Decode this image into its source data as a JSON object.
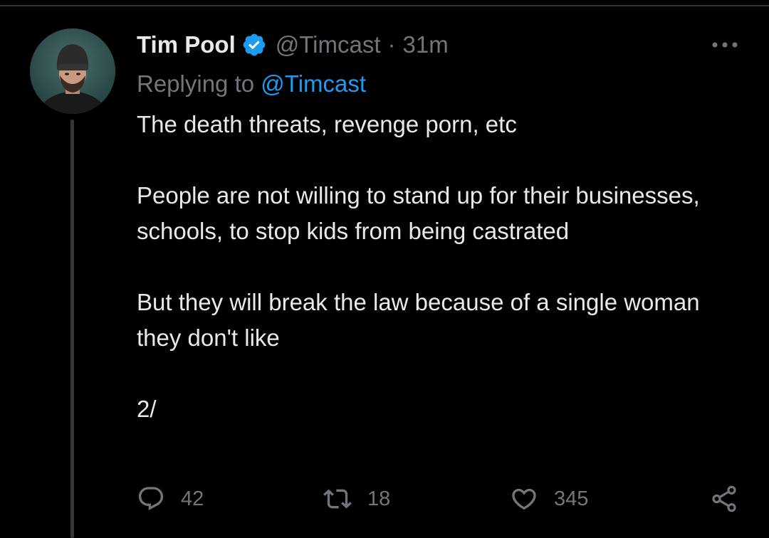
{
  "tweet": {
    "author": {
      "display_name": "Tim Pool",
      "handle": "@Timcast",
      "verified": true,
      "avatar": "avatar-photo"
    },
    "separator": "·",
    "time": "31m",
    "replying_to": {
      "prefix": "Replying to ",
      "handle": "@Timcast"
    },
    "paragraphs": [
      "The death threats, revenge porn, etc",
      "People are not willing to stand up for their businesses, schools, to stop kids from being castrated",
      "But they will break the law because of a single woman they don't like",
      "2/"
    ],
    "actions": {
      "replies": "42",
      "retweets": "18",
      "likes": "345"
    }
  },
  "icons": {
    "verified": "verified-badge-icon",
    "more": "more-horizontal-icon",
    "reply": "reply-bubble-icon",
    "retweet": "retweet-icon",
    "like": "heart-icon",
    "share": "share-icon"
  },
  "colors": {
    "background": "#000000",
    "text": "#e7e9ea",
    "secondary": "#71767b",
    "accent": "#1d9bf0",
    "thread_line": "#333639"
  }
}
